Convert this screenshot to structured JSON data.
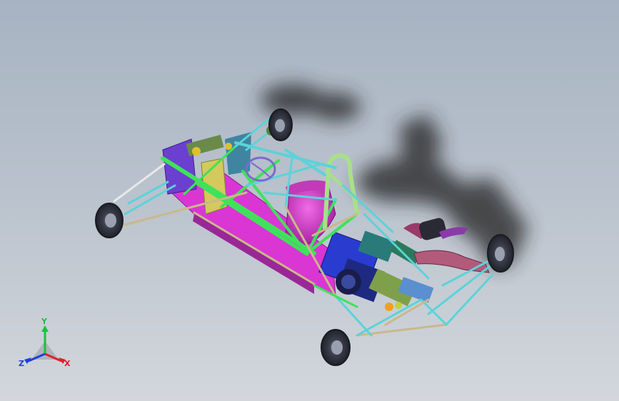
{
  "viewport": {
    "model": "go-kart-chassis",
    "colors": {
      "background_top": "#a7b3c2",
      "background_bottom": "#d3d7dc",
      "shadow": "#2b2b2b",
      "frame_cyan": "#5bd3d8",
      "frame_green": "#3fe25a",
      "frame_yellow": "#d4c95c",
      "frame_beige": "#c9b98a",
      "floor_magenta": "#d936d4",
      "seat_magenta": "#c23ab7",
      "engine_blue": "#2a3bd0",
      "engine_teal": "#2a7a7a",
      "exhaust_pink": "#b25a7a",
      "panel_purple": "#6b3fcf",
      "tire_dark": "#2a2a34"
    }
  },
  "triad": {
    "x_label": "X",
    "y_label": "Y",
    "z_label": "Z",
    "x_color": "#e0202a",
    "y_color": "#19c23c",
    "z_color": "#1a3fe0"
  }
}
